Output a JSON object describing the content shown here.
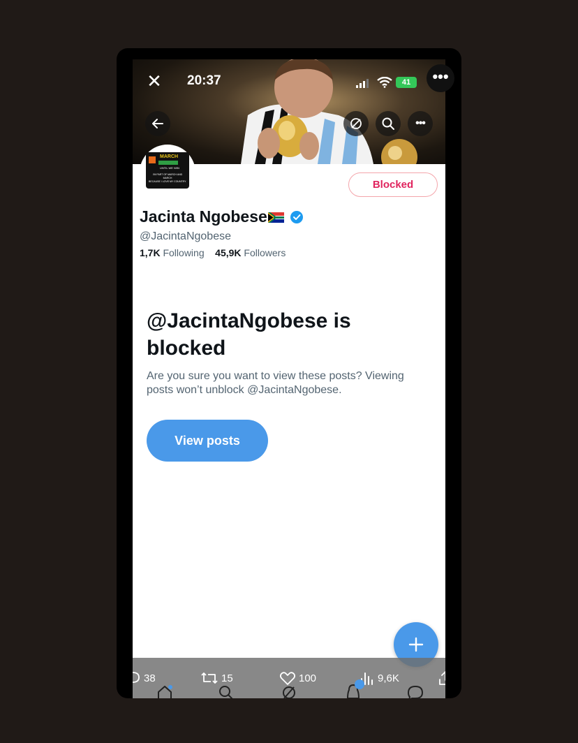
{
  "status_bar": {
    "time": "20:37",
    "battery": "41"
  },
  "profile": {
    "display_name": "Jacinta Ngobese",
    "handle": "@JacintaNgobese",
    "following_count": "1,7K",
    "following_label": "Following",
    "followers_count": "45,9K",
    "followers_label": "Followers",
    "blocked_button": "Blocked",
    "avatar_text": [
      "MARCH",
      "UNTIL WE WIN",
      "I'M PART OF MARCH AND MARCH",
      "BECAUSE I LOVE MY COUNTRY."
    ]
  },
  "blocked_notice": {
    "title": "@JacintaNgobese is blocked",
    "description": "Are you sure you want to view these posts? Viewing posts won’t unblock @JacintaNgobese.",
    "view_button": "View posts"
  },
  "post_metrics": {
    "replies": "38",
    "reposts": "15",
    "likes": "100",
    "views": "9,6K"
  },
  "colors": {
    "accent": "#4a99e9",
    "blocked_red": "#e0245e",
    "battery_green": "#34c759"
  },
  "icons": [
    "close-icon",
    "wifi-icon",
    "signal-icon",
    "battery-icon",
    "more-icon",
    "back-arrow-icon",
    "grok-icon",
    "search-icon",
    "verified-badge-icon",
    "plus-icon",
    "reply-icon",
    "repost-icon",
    "like-icon",
    "views-icon",
    "share-icon",
    "home-icon",
    "search-nav-icon",
    "grok-nav-icon",
    "notifications-icon",
    "messages-icon"
  ]
}
